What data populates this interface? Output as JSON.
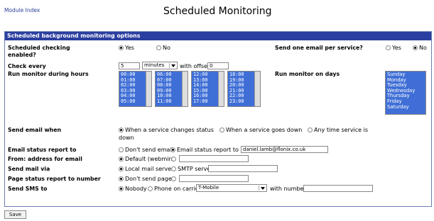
{
  "header": {
    "module_index": "Module Index",
    "title": "Scheduled Monitoring"
  },
  "section_title": "Scheduled background monitoring options",
  "scheduled": {
    "label_line1": "Scheduled checking",
    "label_line2": "enabled?",
    "yes": "Yes",
    "no": "No",
    "selected": "Yes"
  },
  "one_email": {
    "label": "Send one email per service?",
    "yes": "Yes",
    "no": "No",
    "selected": "No"
  },
  "check_every": {
    "label": "Check every",
    "value": "5",
    "unit": "minutes",
    "offset_label": "with offset",
    "offset_value": "0"
  },
  "hours": {
    "label": "Run monitor during hours",
    "columns": [
      [
        "00:00",
        "01:00",
        "02:00",
        "03:00",
        "04:00",
        "05:00"
      ],
      [
        "06:00",
        "07:00",
        "08:00",
        "09:00",
        "10:00",
        "11:00"
      ],
      [
        "12:00",
        "13:00",
        "14:00",
        "15:00",
        "16:00",
        "17:00"
      ],
      [
        "18:00",
        "19:00",
        "20:00",
        "21:00",
        "22:00",
        "23:00"
      ]
    ]
  },
  "days": {
    "label": "Run monitor on days",
    "items": [
      "Sunday",
      "Monday",
      "Tuesday",
      "Wednesday",
      "Thursday",
      "Friday",
      "Saturday"
    ]
  },
  "send_email_when": {
    "label": "Send email when",
    "opt1": "When a service changes status",
    "opt2": "When a service goes down",
    "opt3_line1": "Any time service is",
    "opt3_line2": "down",
    "selected": "When a service changes status"
  },
  "email_report": {
    "label": "Email status report to",
    "opt_none": "Don't send email",
    "opt_to": "Email status report to",
    "value": "daniel.lamb@flonix.co.uk",
    "selected": "Email status report to"
  },
  "from_address": {
    "label": "From: address for email",
    "opt_default": "Default (webmin)",
    "value": "",
    "selected": "Default (webmin)"
  },
  "mail_via": {
    "label": "Send mail via",
    "opt_local": "Local mail server",
    "opt_smtp": "SMTP server",
    "value": "",
    "selected": "Local mail server"
  },
  "page_report": {
    "label": "Page status report to number",
    "opt_none": "Don't send pages",
    "value": "",
    "selected": "Don't send pages"
  },
  "sms": {
    "label": "Send SMS to",
    "opt_nobody": "Nobody",
    "opt_phone": "Phone on carrier",
    "carrier": "T-Mobile",
    "with_number": "with number",
    "number": "",
    "selected": "Nobody"
  },
  "save_label": "Save"
}
